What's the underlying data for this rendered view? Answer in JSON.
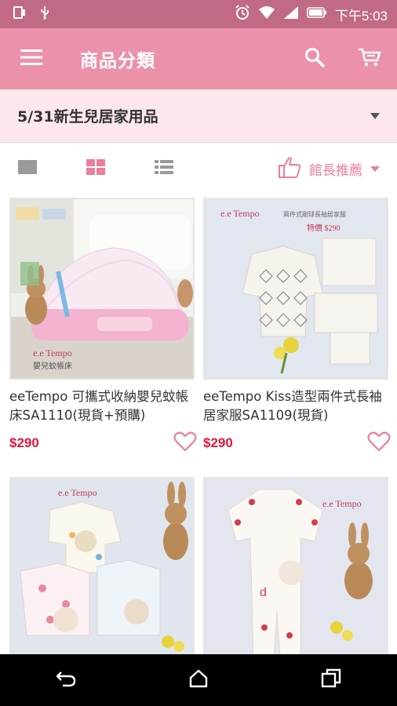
{
  "status_bar": {
    "time": "下午5:03",
    "icons": [
      "tablet-icon",
      "usb-icon",
      "alarm-icon",
      "wifi-icon",
      "signal-icon",
      "battery-icon"
    ]
  },
  "app_bar": {
    "title": "商品分類",
    "background": "#ec91aa",
    "icons": [
      "menu-icon",
      "search-icon",
      "cart-icon"
    ]
  },
  "category": {
    "selected": "5/31新生兒居家用品"
  },
  "toolbar": {
    "views": [
      "single-view-icon",
      "grid-view-icon",
      "list-view-icon"
    ],
    "active_view": "grid",
    "sort_label": "館長推薦",
    "accent": "#ec7d9c"
  },
  "products": [
    {
      "title": "eeTempo 可攜式收納嬰兒蚊帳床SA1110(現貨+預購)",
      "price": "$290",
      "image_text": "e.e Tempo",
      "image_caption": "嬰兒蚊帳床"
    },
    {
      "title": "eeTempo Kiss造型兩件式長袖居家服SA1109(現貨)",
      "price": "$290",
      "image_text": "e.e Tempo",
      "image_caption": "兩件式剛球長袖居家服",
      "image_price": "特價 $290"
    },
    {
      "title": "",
      "price": "",
      "image_text": "e.e Tempo"
    },
    {
      "title": "",
      "price": "",
      "image_text": "e.e Tempo"
    }
  ],
  "nav_bar": {
    "icons": [
      "back-icon",
      "home-icon",
      "recents-icon"
    ]
  },
  "colors": {
    "status_bar": "#c06a84",
    "category_bar": "#fbe7ec",
    "price": "#e8143c"
  }
}
